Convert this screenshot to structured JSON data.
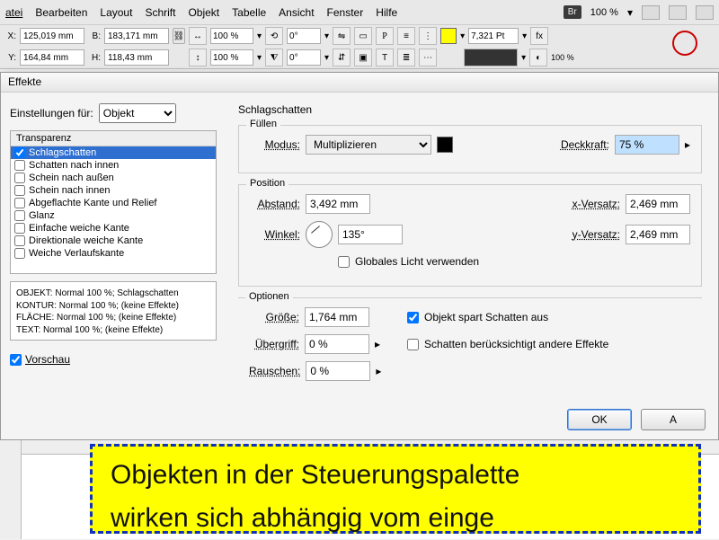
{
  "menu": {
    "items": [
      "atei",
      "Bearbeiten",
      "Layout",
      "Schrift",
      "Objekt",
      "Tabelle",
      "Ansicht",
      "Fenster",
      "Hilfe"
    ],
    "br": "Br",
    "zoom": "100 %"
  },
  "ctrl": {
    "x": "125,019 mm",
    "b": "183,171 mm",
    "y": "164,84 mm",
    "h": "118,43 mm",
    "scale1": "100 %",
    "scale2": "100 %",
    "rot1": "0°",
    "rot2": "0°",
    "stroke_pt": "7,321 Pt",
    "zoom_small": "100 %"
  },
  "dialog": {
    "title": "Effekte",
    "settings_label": "Einstellungen für:",
    "settings_value": "Objekt",
    "fx_header": "Transparenz",
    "fx_items": [
      {
        "label": "Schlagschatten",
        "checked": true,
        "selected": true
      },
      {
        "label": "Schatten nach innen",
        "checked": false
      },
      {
        "label": "Schein nach außen",
        "checked": false
      },
      {
        "label": "Schein nach innen",
        "checked": false
      },
      {
        "label": "Abgeflachte Kante und Relief",
        "checked": false
      },
      {
        "label": "Glanz",
        "checked": false
      },
      {
        "label": "Einfache weiche Kante",
        "checked": false
      },
      {
        "label": "Direktionale weiche Kante",
        "checked": false
      },
      {
        "label": "Weiche Verlaufskante",
        "checked": false
      }
    ],
    "summary": [
      "OBJEKT: Normal 100 %; Schlagschatten",
      "KONTUR: Normal 100 %; (keine Effekte)",
      "FLÄCHE: Normal 100 %; (keine Effekte)",
      "TEXT: Normal 100 %; (keine Effekte)"
    ],
    "preview": "Vorschau",
    "section": "Schlagschatten",
    "fill": {
      "legend": "Füllen",
      "modus_label": "Modus:",
      "modus_value": "Multiplizieren",
      "opacity_label": "Deckkraft:",
      "opacity_value": "75 %"
    },
    "pos": {
      "legend": "Position",
      "abstand_label": "Abstand:",
      "abstand": "3,492 mm",
      "winkel_label": "Winkel:",
      "winkel": "135°",
      "global": "Globales Licht verwenden",
      "xv_label": "x-Versatz:",
      "xv": "2,469 mm",
      "yv_label": "y-Versatz:",
      "yv": "2,469 mm"
    },
    "opt": {
      "legend": "Optionen",
      "size_label": "Größe:",
      "size": "1,764 mm",
      "ueber_label": "Übergriff:",
      "ueber": "0 %",
      "rausch_label": "Rauschen:",
      "rausch": "0 %",
      "spart": "Objekt spart Schatten aus",
      "other": "Schatten berücksichtigt andere Effekte"
    },
    "ok": "OK",
    "cancel": "A"
  },
  "canvas": {
    "line1": "Objekten in der Steuerungspalette",
    "line2": "wirken sich abhängig vom einge"
  }
}
